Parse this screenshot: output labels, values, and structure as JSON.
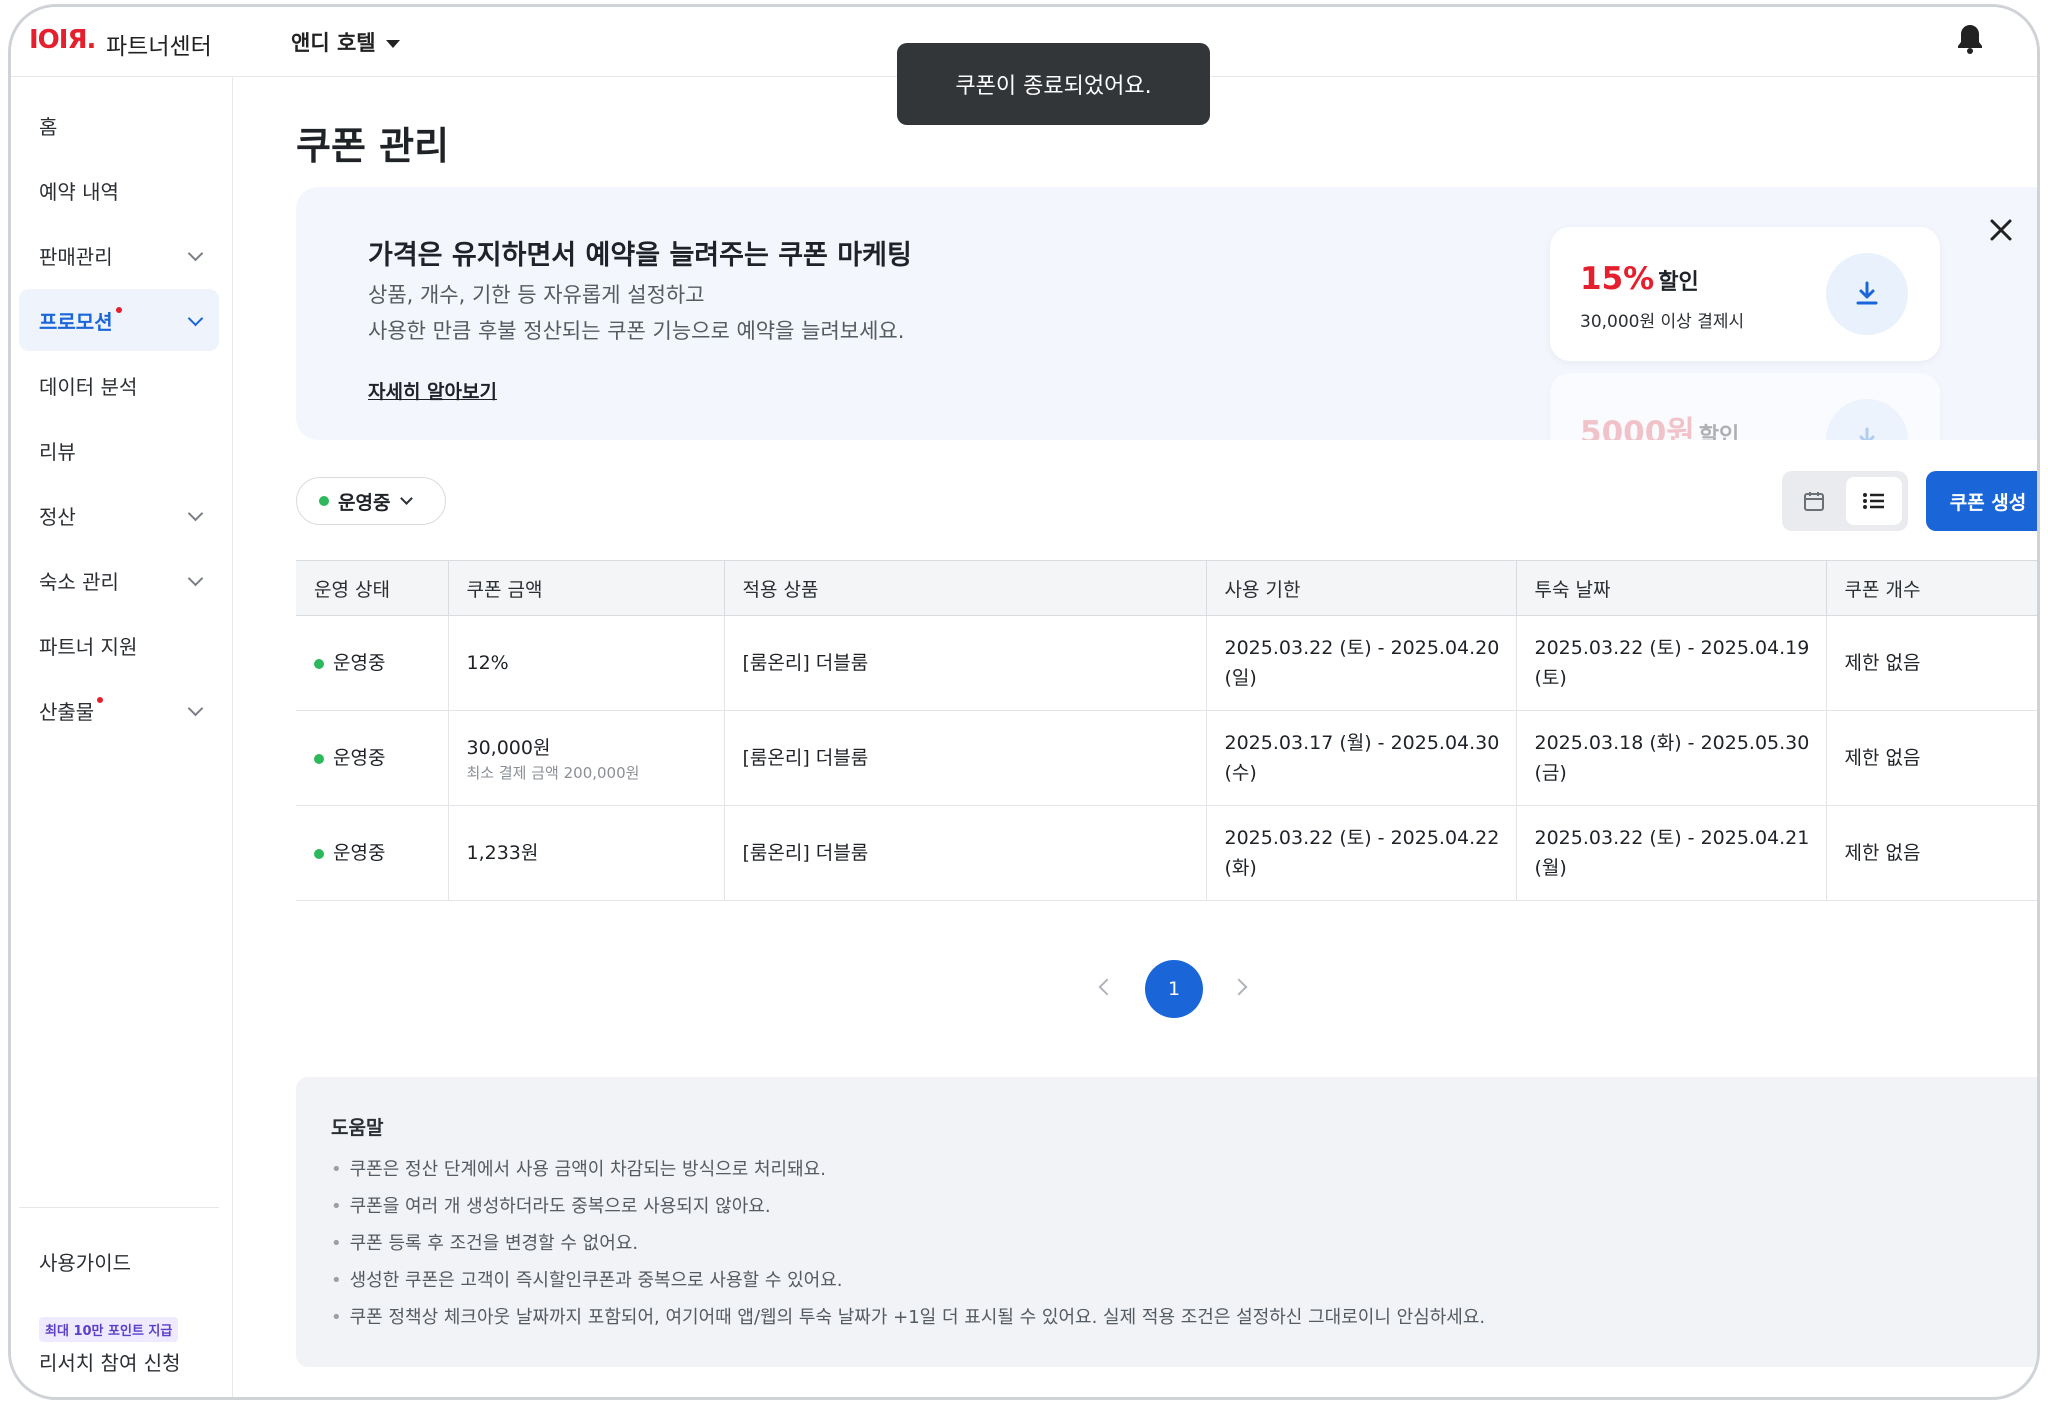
{
  "header": {
    "logo": "ЮЮIОIЗ.",
    "logo_sub": "파트너센터",
    "hotel": "앤디 호텔"
  },
  "toast": "쿠폰이 종료되었어요.",
  "sidebar": {
    "items": [
      {
        "label": "홈"
      },
      {
        "label": "예약 내역"
      },
      {
        "label": "판매관리"
      },
      {
        "label": "프로모션"
      },
      {
        "label": "데이터 분석"
      },
      {
        "label": "리뷰"
      },
      {
        "label": "정산"
      },
      {
        "label": "숙소 관리"
      },
      {
        "label": "파트너 지원"
      },
      {
        "label": "산출물"
      }
    ],
    "guide": "사용가이드",
    "research_badge": "최대 10만 포인트 지급",
    "research": "리서치 참여 신청"
  },
  "page": {
    "title": "쿠폰 관리"
  },
  "banner": {
    "title": "가격은 유지하면서 예약을 늘려주는 쿠폰 마케팅",
    "desc1": "상품, 개수, 기한 등 자유롭게 설정하고",
    "desc2": "사용한 만큼 후불 정산되는 쿠폰 기능으로 예약을 늘려보세요.",
    "link": "자세히 알아보기",
    "cards": [
      {
        "amount": "15%",
        "label": "할인",
        "condition": "30,000원 이상 결제시"
      },
      {
        "amount": "5000원",
        "label": "할인",
        "condition": ""
      }
    ]
  },
  "filter": {
    "status": "운영중",
    "create_button": "쿠폰 생성"
  },
  "table": {
    "headers": [
      "운영 상태",
      "쿠폰 금액",
      "적용 상품",
      "사용 기한",
      "투숙 날짜",
      "쿠폰 개수"
    ],
    "rows": [
      {
        "status": "운영중",
        "amount": "12%",
        "amount_note": "",
        "product": "[룸온리] 더블룸",
        "use_period": "2025.03.22 (토) - 2025.04.20 (일)",
        "stay_period": "2025.03.22 (토) - 2025.04.19 (토)",
        "count": "제한 없음"
      },
      {
        "status": "운영중",
        "amount": "30,000원",
        "amount_note": "최소 결제 금액 200,000원",
        "product": "[룸온리] 더블룸",
        "use_period": "2025.03.17 (월) - 2025.04.30 (수)",
        "stay_period": "2025.03.18 (화) - 2025.05.30 (금)",
        "count": "제한 없음"
      },
      {
        "status": "운영중",
        "amount": "1,233원",
        "amount_note": "",
        "product": "[룸온리] 더블룸",
        "use_period": "2025.03.22 (토) - 2025.04.22 (화)",
        "stay_period": "2025.03.22 (토) - 2025.04.21 (월)",
        "count": "제한 없음"
      }
    ]
  },
  "pagination": {
    "current": "1"
  },
  "help": {
    "title": "도움말",
    "items": [
      "쿠폰은 정산 단계에서 사용 금액이 차감되는 방식으로 처리돼요.",
      "쿠폰을 여러 개 생성하더라도 중복으로 사용되지 않아요.",
      "쿠폰 등록 후 조건을 변경할 수 없어요.",
      "생성한 쿠폰은 고객이 즉시할인쿠폰과 중복으로 사용할 수 있어요.",
      "쿠폰 정책상 체크아웃 날짜까지 포함되어, 여기어때 앱/웹의 투숙 날짜가 +1일 더 표시될 수 있어요. 실제 적용 조건은 설정하신 그대로이니 안심하세요."
    ]
  },
  "colors": {
    "accent": "#1a66d9",
    "brand": "#e5202e",
    "status_green": "#2eb85c"
  }
}
